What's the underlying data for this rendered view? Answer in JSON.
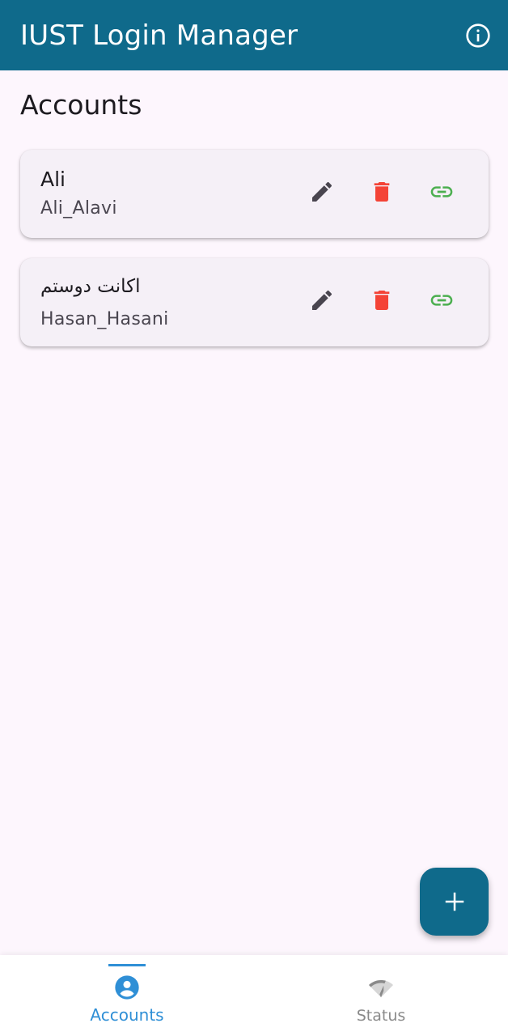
{
  "app": {
    "title": "IUST Login Manager"
  },
  "header": {
    "info_icon": "info-icon"
  },
  "main": {
    "section_title": "Accounts",
    "accounts": [
      {
        "name": "Ali",
        "username": "Ali_Alavi"
      },
      {
        "name": "اکانت دوستم",
        "username": "Hasan_Hasani"
      }
    ]
  },
  "fab": {
    "icon": "plus-icon"
  },
  "bottom_nav": {
    "items": [
      {
        "label": "Accounts",
        "icon": "account-circle-icon",
        "active": true
      },
      {
        "label": "Status",
        "icon": "wifi-status-icon",
        "active": false
      }
    ]
  },
  "colors": {
    "primary": "#0f6a8b",
    "background": "#fdf6fd",
    "edit": "#49454f",
    "delete": "#f44336",
    "link": "#4caf50",
    "nav_active": "#2f8fd6",
    "nav_inactive": "#8a8a8a"
  }
}
